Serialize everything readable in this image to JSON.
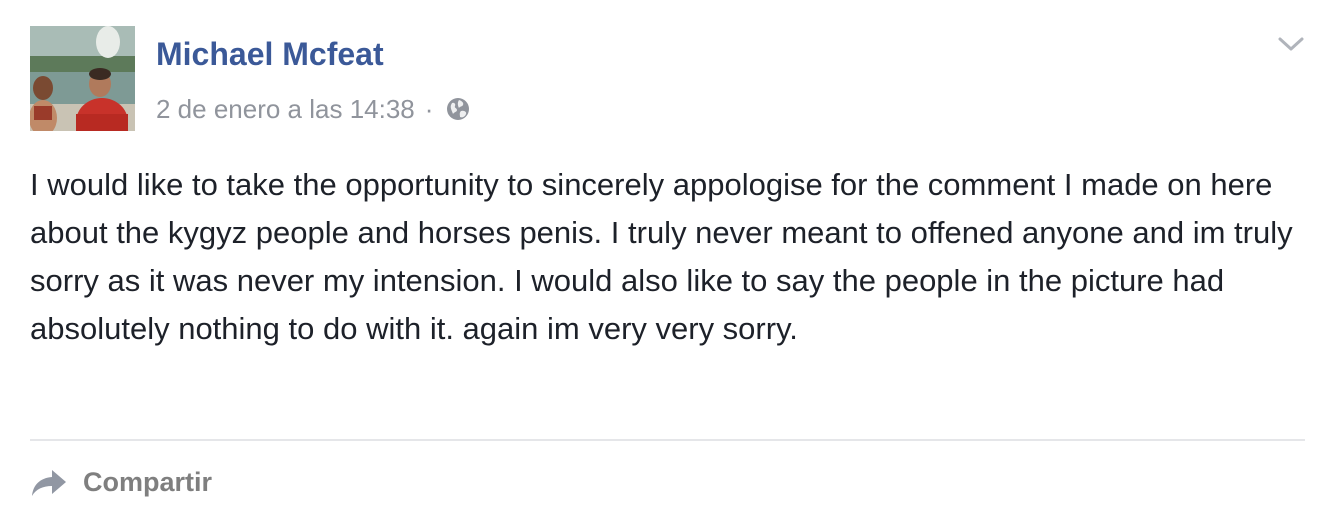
{
  "post": {
    "author_name": "Michael Mcfeat",
    "timestamp": "2 de enero a las 14:38",
    "separator": "·",
    "audience_icon": "globe-icon",
    "menu_icon": "chevron-down-icon",
    "text": "I would like to take the opportunity to sincerely appologise for the comment I made on here about the kygyz people and horses penis. I truly never meant to offened anyone and im truly sorry as it was never my intension. I would also like to say the people in the picture had absolutely nothing to do with it. again im very very sorry."
  },
  "actions": {
    "share_label": "Compartir",
    "share_icon": "share-arrow-icon"
  },
  "colors": {
    "author_link": "#3b5998",
    "meta_text": "#90949c",
    "body_text": "#1d2129",
    "action_text": "#7f7f7f",
    "divider": "#e5e6e9"
  }
}
